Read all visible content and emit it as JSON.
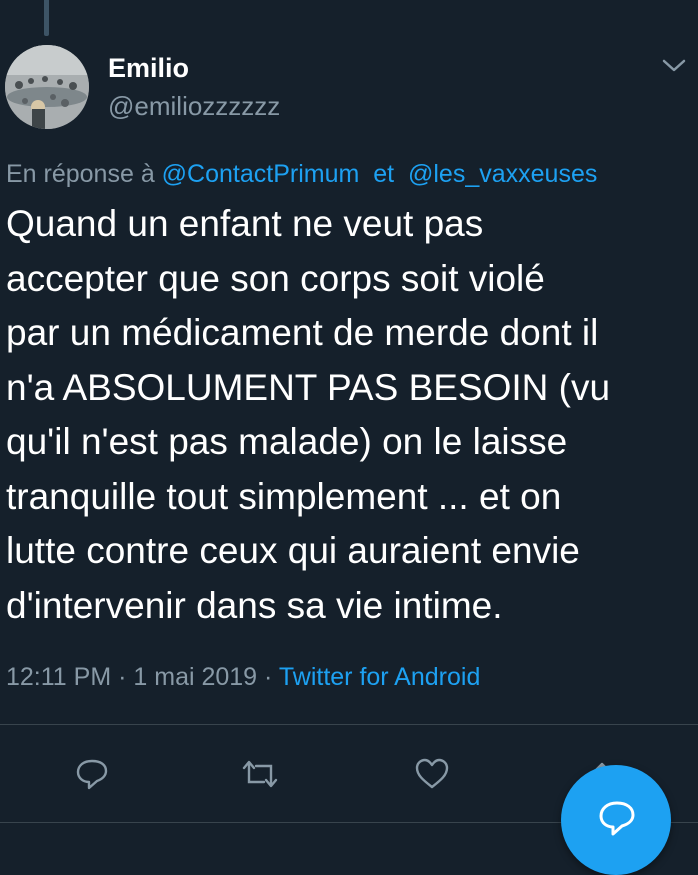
{
  "author": {
    "name": "Emilio",
    "handle": "@emiliozzzzzz",
    "avatar_icon": "avatar-photo"
  },
  "reply_context": {
    "prefix": "En réponse à",
    "mention_1": "@ContactPrimum",
    "conjunction": "et",
    "mention_2": "@les_vaxxeuses"
  },
  "tweet": {
    "lines": [
      "Quand un enfant ne veut pas",
      "accepter que son corps soit violé",
      "par un médicament de merde dont il",
      "n'a ABSOLUMENT PAS BESOIN (vu",
      "qu'il n'est pas malade) on le laisse",
      "tranquille tout simplement ... et on",
      "lutte contre ceux qui auraient envie",
      "d'intervenir dans sa vie intime."
    ]
  },
  "meta": {
    "time": "12:11 PM",
    "separator": "·",
    "date": "1 mai 2019",
    "source": "Twitter for Android"
  },
  "actions": {
    "reply_icon": "reply-icon",
    "retweet_icon": "retweet-icon",
    "like_icon": "heart-icon",
    "share_icon": "share-icon",
    "compose_icon": "compose-reply-icon"
  },
  "colors": {
    "background": "#15202b",
    "accent": "#1da1f2",
    "secondary_text": "#8899a6",
    "divider": "#38444d"
  }
}
